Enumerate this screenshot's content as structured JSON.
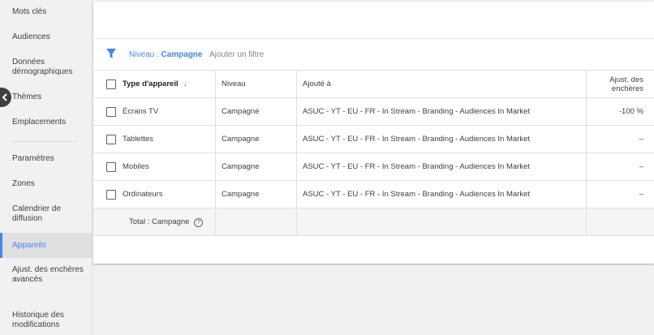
{
  "sidebar": {
    "items": [
      {
        "label": "Mots clés"
      },
      {
        "label": "Audiences"
      },
      {
        "label": "Données démographiques"
      },
      {
        "label": "Thèmes"
      },
      {
        "label": "Emplacements"
      },
      {
        "label": "Paramètres"
      },
      {
        "label": "Zones"
      },
      {
        "label": "Calendrier de diffusion"
      },
      {
        "label": "Appareils",
        "active": true
      },
      {
        "label": "Ajust. des enchères avancés"
      },
      {
        "label": "Historique des modifications"
      }
    ],
    "collapse_icon": "chevron-left-icon"
  },
  "filter": {
    "icon": "filter-icon",
    "level_prefix": "Niveau : ",
    "level_value": "Campagne",
    "add_filter": "Ajouter un filtre"
  },
  "table": {
    "headers": {
      "type": "Type d'appareil",
      "level": "Niveau",
      "added_to": "Ajouté à",
      "bid_adj": "Ajust. des enchères"
    },
    "rows": [
      {
        "type": "Écrans TV",
        "level": "Campagne",
        "added_to": "ASUC - YT - EU - FR - In Stream - Branding - Audiences In Market",
        "bid_adj": "-100 %"
      },
      {
        "type": "Tablettes",
        "level": "Campagne",
        "added_to": "ASUC - YT - EU - FR - In Stream - Branding - Audiences In Market",
        "bid_adj": "–"
      },
      {
        "type": "Mobiles",
        "level": "Campagne",
        "added_to": "ASUC - YT - EU - FR - In Stream - Branding - Audiences In Market",
        "bid_adj": "–"
      },
      {
        "type": "Ordinateurs",
        "level": "Campagne",
        "added_to": "ASUC - YT - EU - FR - In Stream - Branding - Audiences In Market",
        "bid_adj": "–"
      }
    ],
    "total_label": "Total : Campagne"
  },
  "colors": {
    "accent": "#4285f4",
    "text": "#3c4043",
    "background": "#f1f1f1"
  }
}
